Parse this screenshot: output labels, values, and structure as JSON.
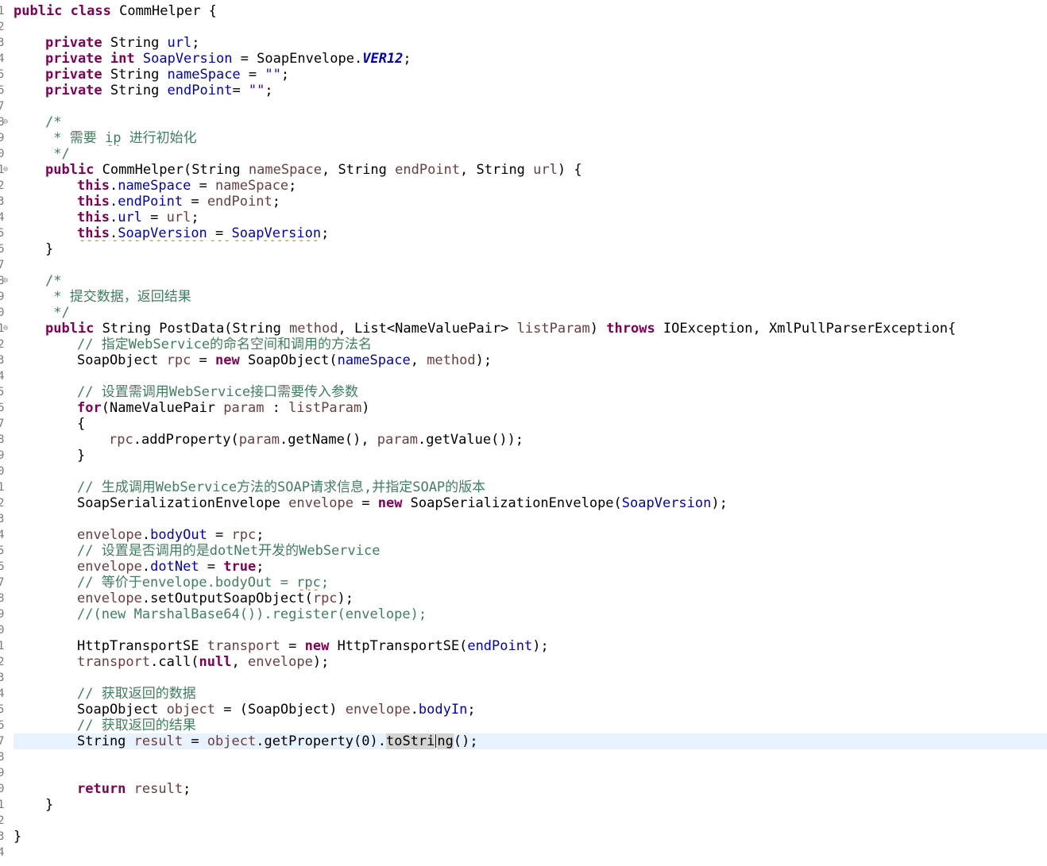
{
  "editor": {
    "colors": {
      "keyword": "#7f0055",
      "field": "#0000c0",
      "string": "#2a00ff",
      "comment": "#3f7f5f",
      "local_variable": "#6a3e3e",
      "current_line": "#e8f2fe",
      "occurrence_highlight": "#d4d4d4"
    },
    "gutter": {
      "line_numbers": [
        "1",
        "2",
        "3",
        "4",
        "5",
        "6",
        "7",
        "8",
        "9",
        "0",
        "1",
        "2",
        "3",
        "4",
        "5",
        "6",
        "7",
        "8",
        "9",
        "0",
        "1",
        "2",
        "3",
        "4",
        "5",
        "6",
        "7",
        "8",
        "9",
        "0",
        "1",
        "2",
        "3",
        "4",
        "5",
        "6",
        "7",
        "8",
        "9",
        "0",
        "1",
        "2",
        "3",
        "4",
        "5",
        "6",
        "7",
        "8",
        "9",
        "0",
        "1",
        "2",
        "3",
        "4"
      ],
      "fold_icon": "minus-collapse-icon"
    },
    "lines": [
      {
        "indent": 0,
        "t": [
          "public",
          "class",
          " CommHelper {"
        ]
      },
      {
        "indent": 0,
        "t": []
      },
      {
        "indent": 1,
        "t": [
          "private",
          " String ",
          "url",
          ";"
        ]
      },
      {
        "indent": 1,
        "t": [
          "private",
          "int",
          " ",
          "SoapVersion",
          " = SoapEnvelope.",
          "VER12",
          ";"
        ]
      },
      {
        "indent": 1,
        "t": [
          "private",
          " String ",
          "nameSpace",
          " = ",
          "\"\"",
          ";"
        ]
      },
      {
        "indent": 1,
        "t": [
          "private",
          " String ",
          "endPoint",
          "= ",
          "\"\"",
          ";"
        ]
      },
      {
        "indent": 0,
        "t": []
      },
      {
        "indent": 1,
        "t": [
          "/*"
        ]
      },
      {
        "indent": 1,
        "t": [
          " * 需要 ",
          "ip",
          " 进行初始化"
        ]
      },
      {
        "indent": 1,
        "t": [
          " */"
        ]
      },
      {
        "indent": 1,
        "t": [
          "public",
          " CommHelper(String ",
          "nameSpace",
          ", String ",
          "endPoint",
          ", String ",
          "url",
          ") {"
        ]
      },
      {
        "indent": 2,
        "t": [
          "this",
          ".",
          "nameSpace",
          " = ",
          "nameSpace",
          ";"
        ]
      },
      {
        "indent": 2,
        "t": [
          "this",
          ".",
          "endPoint",
          " = ",
          "endPoint",
          ";"
        ]
      },
      {
        "indent": 2,
        "t": [
          "this",
          ".",
          "url",
          " = ",
          "url",
          ";"
        ]
      },
      {
        "indent": 2,
        "t": [
          "this",
          ".",
          "SoapVersion",
          " = ",
          "SoapVersion",
          ";"
        ]
      },
      {
        "indent": 1,
        "t": [
          "}"
        ]
      },
      {
        "indent": 0,
        "t": []
      },
      {
        "indent": 1,
        "t": [
          "/*"
        ]
      },
      {
        "indent": 1,
        "t": [
          " * 提交数据，返回结果"
        ]
      },
      {
        "indent": 1,
        "t": [
          " */"
        ]
      },
      {
        "indent": 1,
        "t": [
          "public",
          " String PostData(String ",
          "method",
          ", List<NameValuePair> ",
          "listParam",
          ") ",
          "throws",
          " IOException, XmlPullParserException{"
        ]
      },
      {
        "indent": 2,
        "t": [
          "// 指定WebService的命名空间和调用的方法名"
        ]
      },
      {
        "indent": 2,
        "t": [
          "SoapObject ",
          "rpc",
          " = ",
          "new",
          " SoapObject(",
          "nameSpace",
          ", ",
          "method",
          ");"
        ]
      },
      {
        "indent": 0,
        "t": []
      },
      {
        "indent": 2,
        "t": [
          "// 设置需调用WebService接口需要传入参数"
        ]
      },
      {
        "indent": 2,
        "t": [
          "for",
          "(NameValuePair ",
          "param",
          " : ",
          "listParam",
          ")"
        ]
      },
      {
        "indent": 2,
        "t": [
          "{"
        ]
      },
      {
        "indent": 3,
        "t": [
          "rpc",
          ".addProperty(",
          "param",
          ".getName(), ",
          "param",
          ".getValue());"
        ]
      },
      {
        "indent": 2,
        "t": [
          "}"
        ]
      },
      {
        "indent": 0,
        "t": []
      },
      {
        "indent": 2,
        "t": [
          "// 生成调用WebService方法的SOAP请求信息,并指定SOAP的版本"
        ]
      },
      {
        "indent": 2,
        "t": [
          "SoapSerializationEnvelope ",
          "envelope",
          " = ",
          "new",
          " SoapSerializationEnvelope(",
          "SoapVersion",
          ");"
        ]
      },
      {
        "indent": 0,
        "t": []
      },
      {
        "indent": 2,
        "t": [
          "envelope",
          ".",
          "bodyOut",
          " = ",
          "rpc",
          ";"
        ]
      },
      {
        "indent": 2,
        "t": [
          "// 设置是否调用的是dotNet开发的WebService"
        ]
      },
      {
        "indent": 2,
        "t": [
          "envelope",
          ".",
          "dotNet",
          " = ",
          "true",
          ";"
        ]
      },
      {
        "indent": 2,
        "t": [
          "// 等价于envelope.bodyOut = ",
          "rpc",
          ";"
        ]
      },
      {
        "indent": 2,
        "t": [
          "envelope",
          ".setOutputSoapObject(",
          "rpc",
          ");"
        ]
      },
      {
        "indent": 2,
        "t": [
          "//(new MarshalBase64()).register(envelope);"
        ]
      },
      {
        "indent": 0,
        "t": []
      },
      {
        "indent": 2,
        "t": [
          "HttpTransportSE ",
          "transport",
          " = ",
          "new",
          " HttpTransportSE(",
          "endPoint",
          ");"
        ]
      },
      {
        "indent": 2,
        "t": [
          "transport",
          ".call(",
          "null",
          ", ",
          "envelope",
          ");"
        ]
      },
      {
        "indent": 0,
        "t": []
      },
      {
        "indent": 2,
        "t": [
          "// 获取返回的数据"
        ]
      },
      {
        "indent": 2,
        "t": [
          "SoapObject ",
          "object",
          " = (SoapObject) ",
          "envelope",
          ".",
          "bodyIn",
          ";"
        ]
      },
      {
        "indent": 2,
        "t": [
          "// 获取返回的结果"
        ]
      },
      {
        "indent": 2,
        "t": [
          "String ",
          "result",
          " = ",
          "object",
          ".getProperty(0).",
          "toStri",
          "ng",
          "();"
        ]
      },
      {
        "indent": 0,
        "t": []
      },
      {
        "indent": 0,
        "t": []
      },
      {
        "indent": 2,
        "t": [
          "return",
          " ",
          "result",
          ";"
        ]
      },
      {
        "indent": 1,
        "t": [
          "}"
        ]
      },
      {
        "indent": 0,
        "t": []
      },
      {
        "indent": 0,
        "t": [
          "}"
        ]
      },
      {
        "indent": 0,
        "t": []
      }
    ]
  }
}
